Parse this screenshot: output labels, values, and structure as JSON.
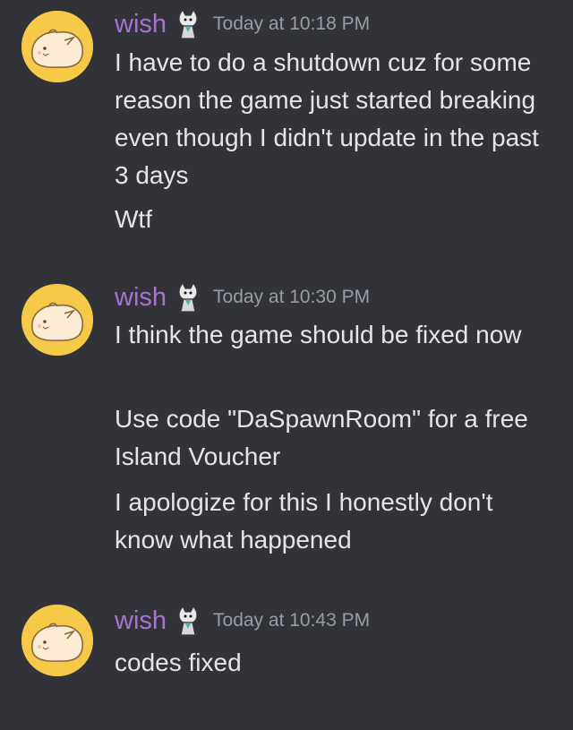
{
  "messages": [
    {
      "username": "wish",
      "timestamp": "Today at 10:18 PM",
      "lines": [
        "I have to do a shutdown cuz for some reason the game just started breaking even though I didn't update in the past 3 days",
        "Wtf"
      ]
    },
    {
      "username": "wish",
      "timestamp": "Today at 10:30 PM",
      "lines": [
        "I think the game should be fixed now",
        "Use code \"DaSpawnRoom\" for a free Island Voucher",
        "I apologize for this I honestly don't know what happened"
      ]
    },
    {
      "username": "wish",
      "timestamp": "Today at 10:43 PM",
      "lines": [
        "codes fixed"
      ]
    }
  ],
  "icons": {
    "avatar": "hamster-avatar-icon",
    "badge": "cat-badge-icon"
  },
  "colors": {
    "background": "#313338",
    "username": "#a873d3",
    "timestamp": "#9a9ca3",
    "message_text": "#e4e5e8",
    "avatar_bg": "#f7c948"
  }
}
